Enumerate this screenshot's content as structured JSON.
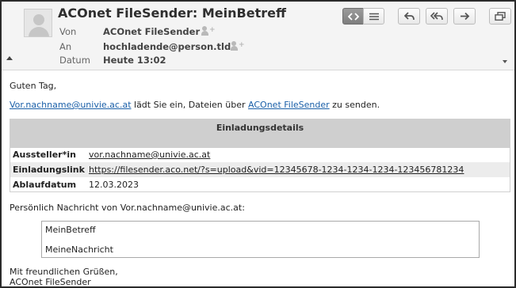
{
  "header": {
    "subject": "ACOnet FileSender: MeinBetreff",
    "from_label": "Von",
    "from_value": "ACOnet FileSender",
    "to_label": "An",
    "to_value": "hochladende@person.tld",
    "date_label": "Datum",
    "date_value": "Heute 13:02"
  },
  "message": {
    "greeting": "Guten Tag,",
    "intro_link": "Vor.nachname@univie.ac.at",
    "intro_mid": " lädt Sie ein, Dateien über ",
    "intro_service_link": "ACOnet FileSender",
    "intro_end": " zu senden.",
    "details": {
      "title": "Einladungsdetails",
      "rows": [
        {
          "key": "Aussteller*in",
          "value": "vor.nachname@univie.ac.at",
          "is_link": true
        },
        {
          "key": "Einladungslink",
          "value": "https://filesender.aco.net/?s=upload&vid=12345678-1234-1234-1234-123456781234",
          "is_link": true
        },
        {
          "key": "Ablaufdatum",
          "value": "12.03.2023",
          "is_link": false
        }
      ]
    },
    "personal_note_intro": "Persönlich Nachricht von Vor.nachname@univie.ac.at:",
    "note_subject": "MeinBetreff",
    "note_text": "MeineNachricht",
    "closing": "Mit freundlichen Grüßen,",
    "signature": "ACOnet FileSender"
  },
  "colors": {
    "link": "#1a5fa8",
    "header_bg": "#f4f4f4",
    "table_header_bg": "#cfcfcf",
    "table_alt_row_bg": "#ececec"
  },
  "icons": {
    "view_toggle": "code-view-icon",
    "list": "list-icon",
    "reply": "reply-icon",
    "reply_all": "reply-all-icon",
    "forward": "forward-icon",
    "new_window": "new-window-icon"
  }
}
